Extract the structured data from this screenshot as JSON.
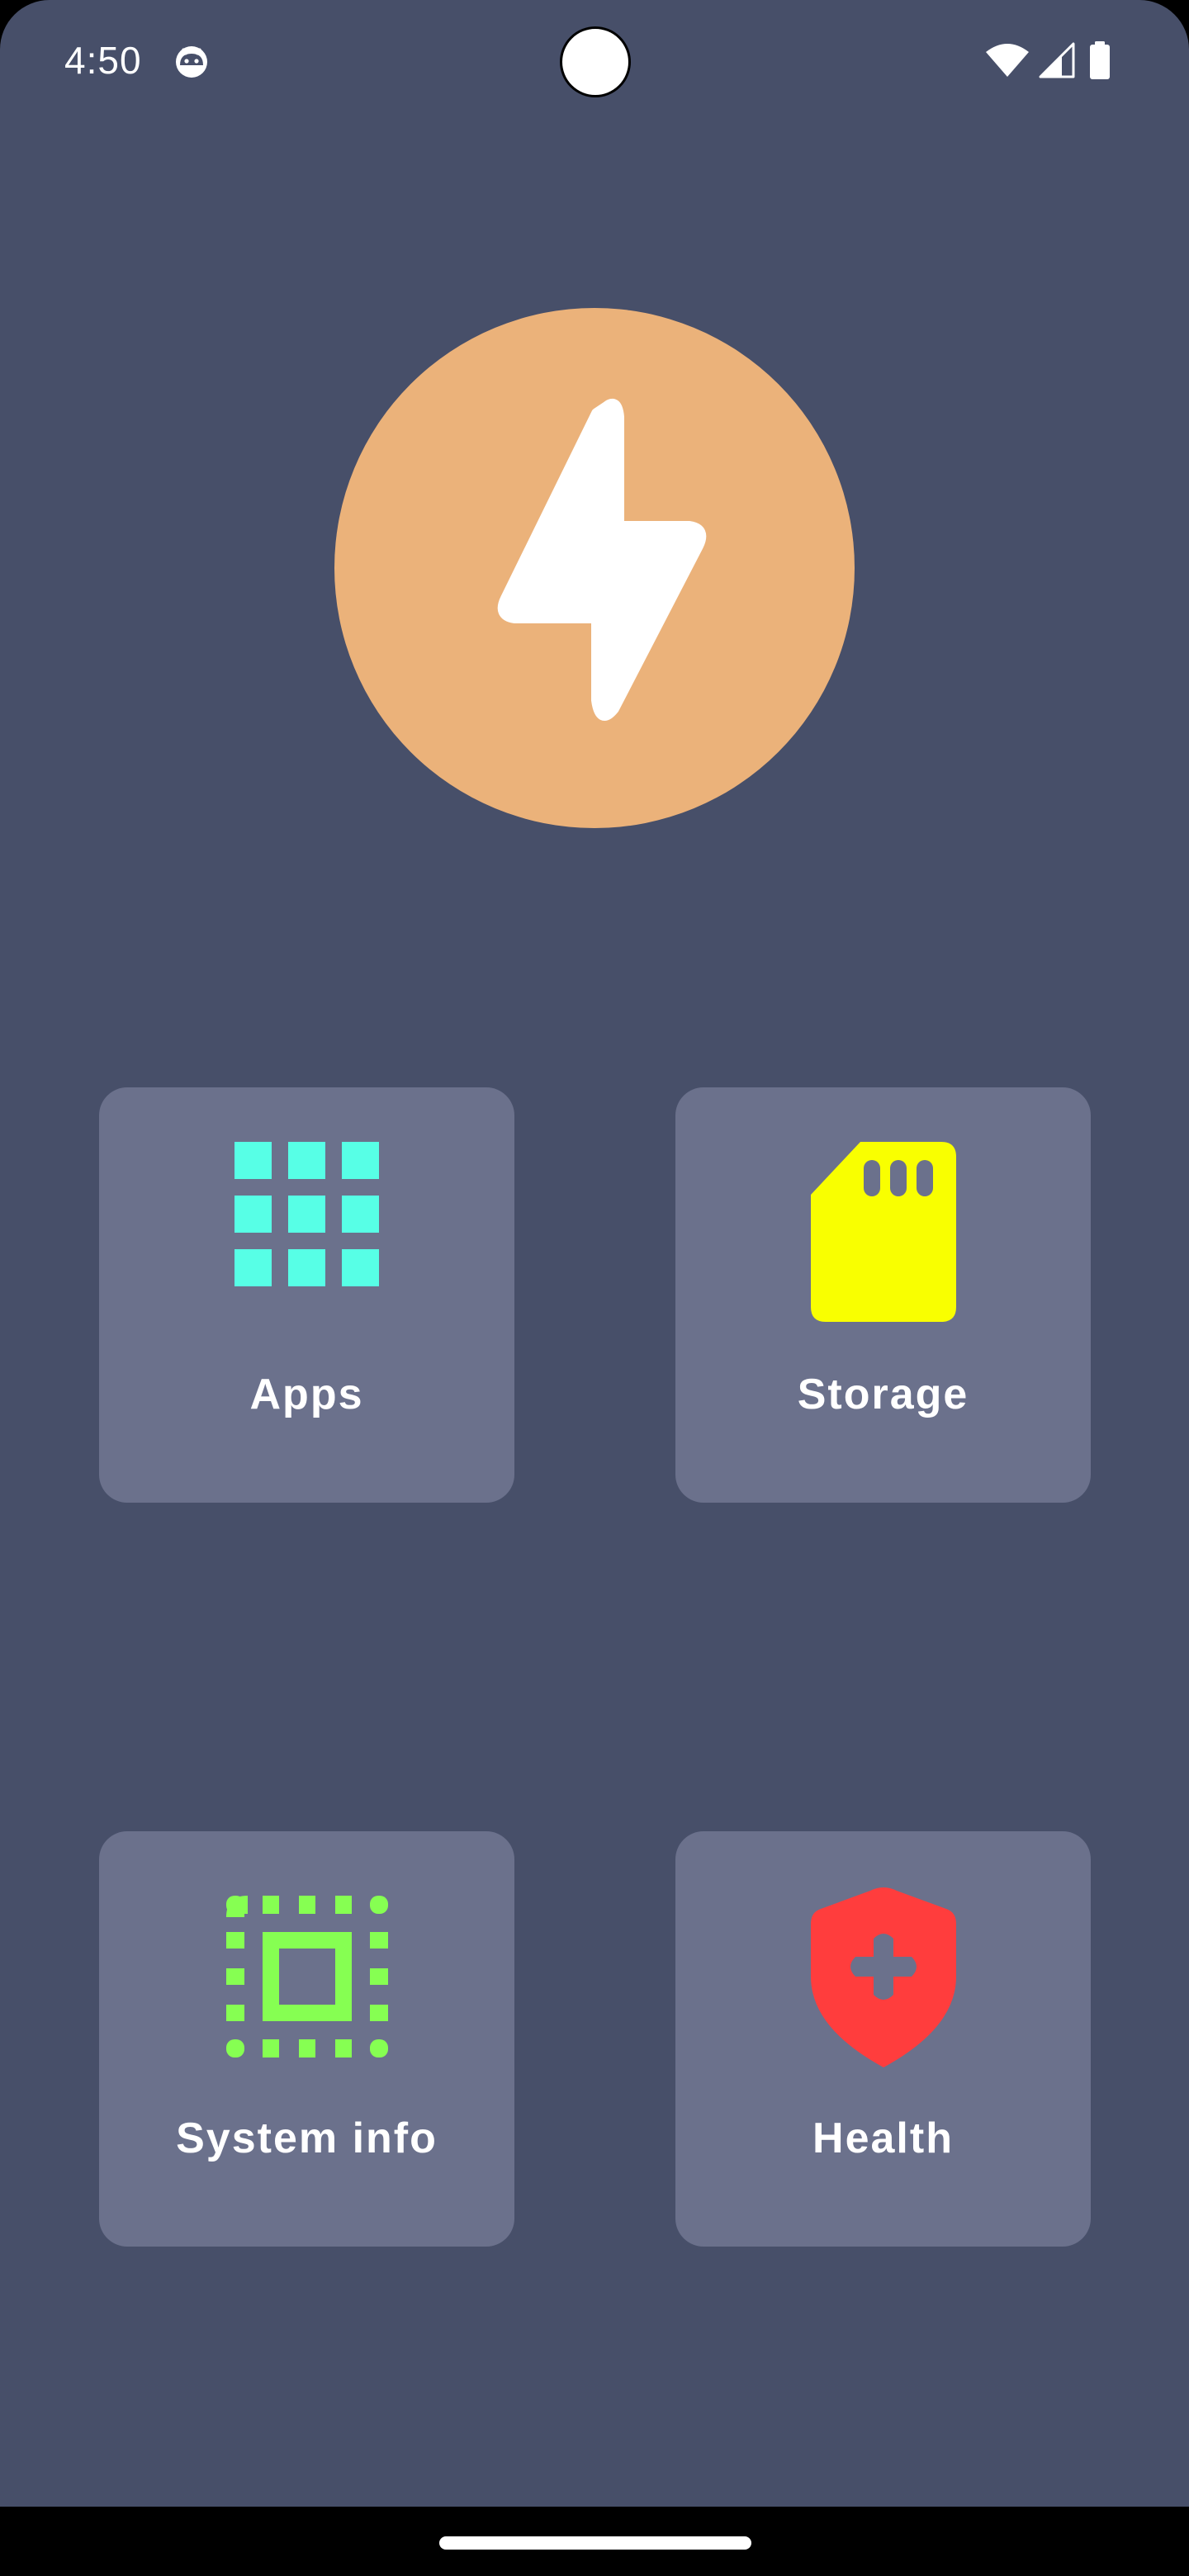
{
  "status_bar": {
    "time": "4:50",
    "app_icon": "android-robot-icon",
    "icons": [
      "wifi-icon",
      "cellular-signal-icon",
      "battery-icon"
    ]
  },
  "hero": {
    "icon": "lightning-bolt-icon",
    "color": "#ebb27a"
  },
  "tiles": [
    {
      "label": "Apps",
      "icon": "apps-grid-icon",
      "icon_color": "#57ffe6"
    },
    {
      "label": "Storage",
      "icon": "sd-card-icon",
      "icon_color": "#f9ff00"
    },
    {
      "label": "System info",
      "icon": "cpu-chip-icon",
      "icon_color": "#86ff52"
    },
    {
      "label": "Health",
      "icon": "health-shield-icon",
      "icon_color": "#ff3d3d"
    }
  ],
  "colors": {
    "background": "#474f69",
    "tile": "#6b718c",
    "text": "#ffffff"
  }
}
